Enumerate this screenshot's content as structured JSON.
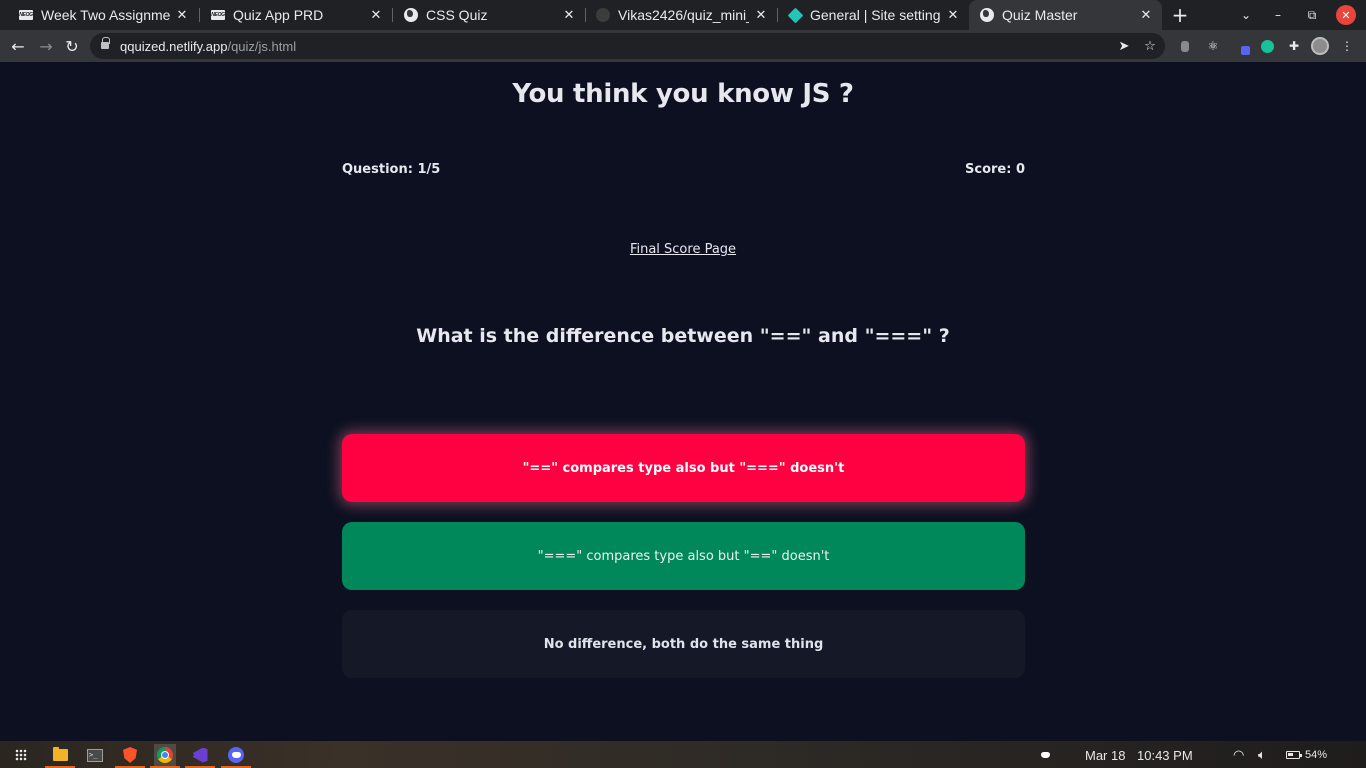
{
  "browser": {
    "tabs": [
      {
        "title": "Week Two Assignmen",
        "icon": "neog-icon"
      },
      {
        "title": "Quiz App PRD",
        "icon": "neog-icon"
      },
      {
        "title": "CSS Quiz",
        "icon": "globe-icon"
      },
      {
        "title": "Vikas2426/quiz_mini_",
        "icon": "github-icon"
      },
      {
        "title": "General | Site settings",
        "icon": "netlify-icon"
      },
      {
        "title": "Quiz Master",
        "icon": "globe-icon",
        "active": true
      }
    ],
    "url_host": "qquized.netlify.app",
    "url_path": "/quiz/js.html"
  },
  "quiz": {
    "title": "You think you know JS ?",
    "question_counter": "Question: 1/5",
    "score": "Score: 0",
    "final_link": "Final Score Page",
    "question": "What is the difference between \"==\" and \"===\" ?",
    "options": [
      {
        "text": "\"==\" compares type also but \"===\" doesn't",
        "state": "wrong",
        "color": "#ff0040"
      },
      {
        "text": "\"===\" compares type also but \"==\" doesn't",
        "state": "correct",
        "color": "#00885a"
      },
      {
        "text": "No difference, both do the same thing",
        "state": "neutral",
        "color": "#151827"
      }
    ]
  },
  "taskbar": {
    "date": "Mar 18",
    "time": "10:43 PM",
    "battery": "54%"
  },
  "colors": {
    "page_background": "#0c1021",
    "wrong": "#ff0040",
    "correct": "#00885a"
  }
}
